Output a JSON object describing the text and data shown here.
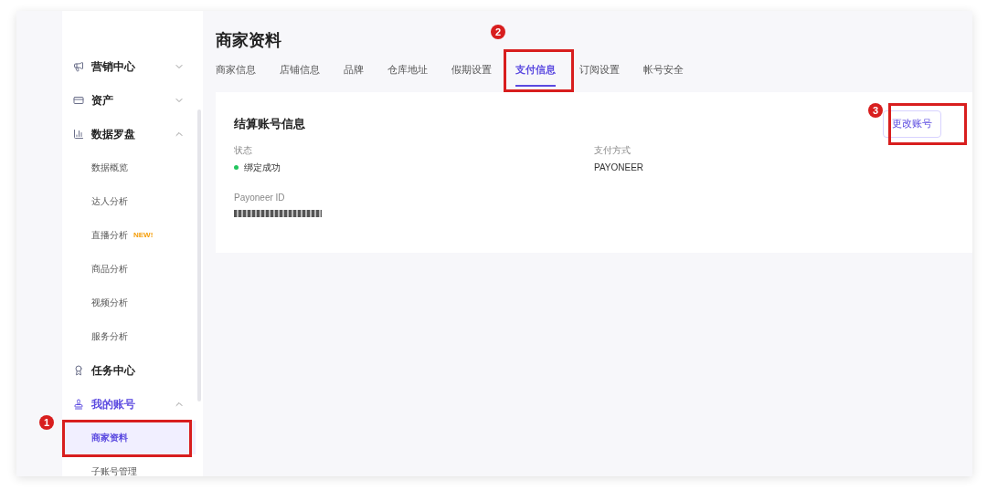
{
  "sidebar": {
    "items": [
      {
        "label": "营销中心",
        "expanded": false,
        "active": false
      },
      {
        "label": "资产",
        "expanded": false,
        "active": false
      },
      {
        "label": "数据罗盘",
        "expanded": true,
        "active": false,
        "children": [
          {
            "label": "数据概览",
            "selected": false
          },
          {
            "label": "达人分析",
            "selected": false
          },
          {
            "label": "直播分析",
            "badge": "NEW!",
            "selected": false
          },
          {
            "label": "商品分析",
            "selected": false
          },
          {
            "label": "视频分析",
            "selected": false
          },
          {
            "label": "服务分析",
            "selected": false
          }
        ]
      },
      {
        "label": "任务中心",
        "active": false
      },
      {
        "label": "我的账号",
        "expanded": true,
        "active": true,
        "children": [
          {
            "label": "商家资料",
            "selected": true
          },
          {
            "label": "子账号管理",
            "selected": false
          }
        ]
      }
    ]
  },
  "page_title": "商家资料",
  "tabs": [
    {
      "label": "商家信息",
      "selected": false
    },
    {
      "label": "店铺信息",
      "selected": false
    },
    {
      "label": "品牌",
      "selected": false
    },
    {
      "label": "仓库地址",
      "selected": false
    },
    {
      "label": "假期设置",
      "selected": false
    },
    {
      "label": "支付信息",
      "selected": true
    },
    {
      "label": "订阅设置",
      "selected": false
    },
    {
      "label": "帐号安全",
      "selected": false
    }
  ],
  "card": {
    "title": "结算账号信息",
    "button": "更改账号",
    "fields": [
      {
        "label": "状态",
        "kind": "text",
        "value": "绑定成功",
        "color": "#22c55e"
      },
      {
        "label": "支付方式",
        "kind": "text",
        "value": "PAYONEER"
      },
      {
        "label": "Payoneer ID",
        "kind": "redacted"
      }
    ]
  },
  "annotations": [
    {
      "label": "1"
    },
    {
      "label": "2"
    },
    {
      "label": "3"
    }
  ]
}
